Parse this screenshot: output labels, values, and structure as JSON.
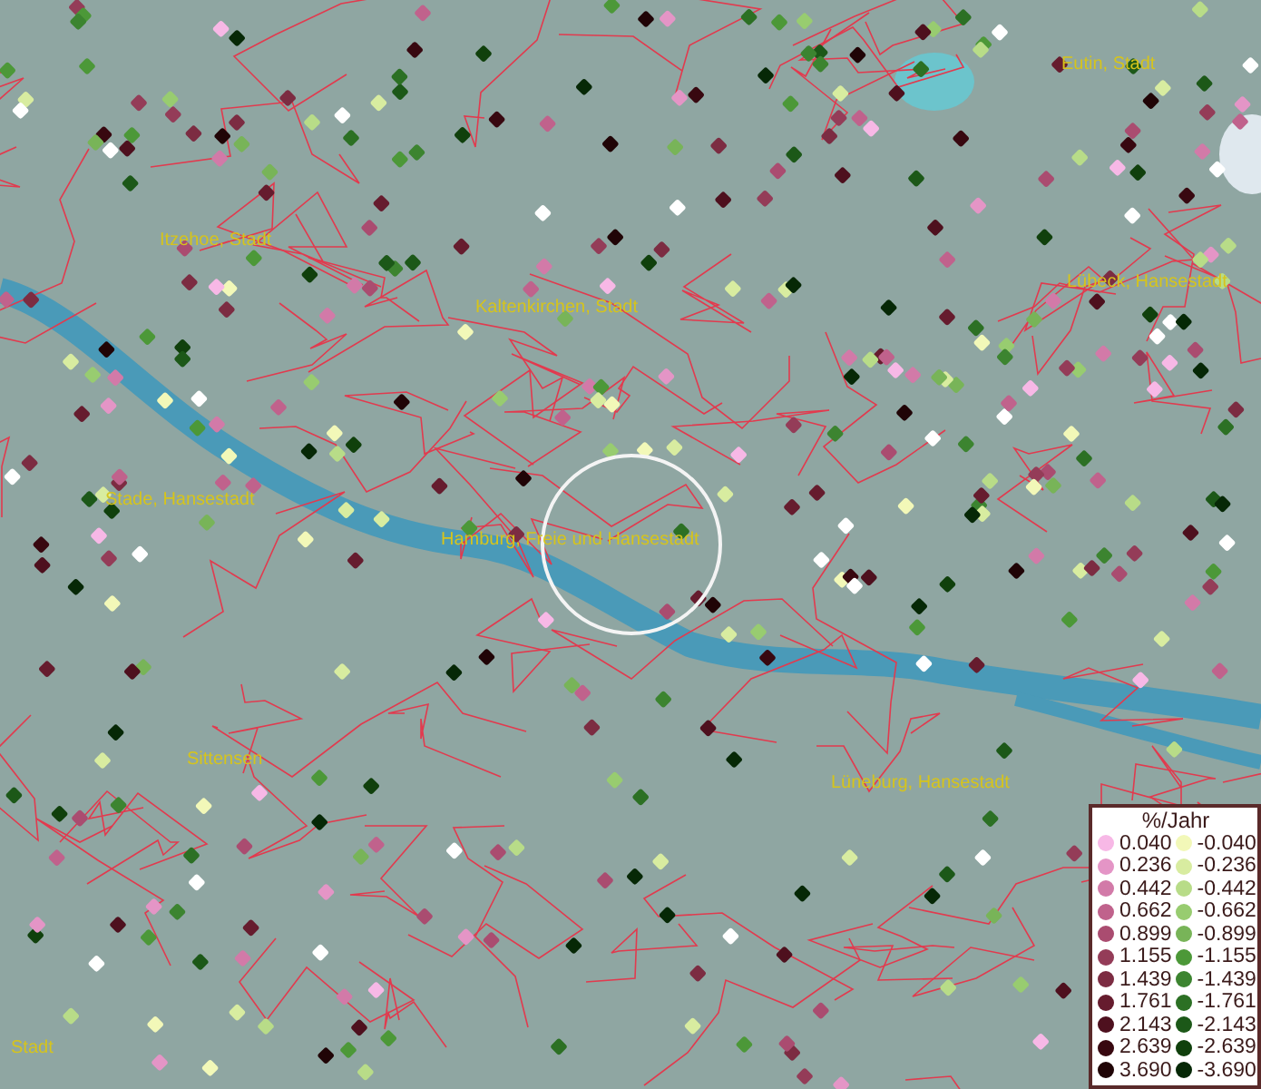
{
  "map": {
    "places": [
      {
        "label": "Eutin, Stadt"
      },
      {
        "label": "Itzehoe, Stadt"
      },
      {
        "label": "Lübeck, Hansestadt"
      },
      {
        "label": "Kaltenkirchen, Stadt"
      },
      {
        "label": "Stade, Hansestadt"
      },
      {
        "label": "Hamburg, Freie und Hansestadt"
      },
      {
        "label": "Sittensen"
      },
      {
        "label": "Lüneburg, Hansestadt"
      },
      {
        "label": "Stadt"
      }
    ]
  },
  "legend": {
    "title": "%/Jahr",
    "increase": [
      {
        "label": "0.040",
        "color": "#f7b8e6"
      },
      {
        "label": "0.236",
        "color": "#e495c6"
      },
      {
        "label": "0.442",
        "color": "#d27aa8"
      },
      {
        "label": "0.662",
        "color": "#c0628c"
      },
      {
        "label": "0.899",
        "color": "#aa4c70"
      },
      {
        "label": "1.155",
        "color": "#943c58"
      },
      {
        "label": "1.439",
        "color": "#7c2c42"
      },
      {
        "label": "1.761",
        "color": "#661c2e"
      },
      {
        "label": "2.143",
        "color": "#4e101e"
      },
      {
        "label": "2.639",
        "color": "#380810"
      },
      {
        "label": "3.690",
        "color": "#200406"
      }
    ],
    "decrease": [
      {
        "label": "-0.040",
        "color": "#f2f8b8"
      },
      {
        "label": "-0.236",
        "color": "#d8eca0"
      },
      {
        "label": "-0.442",
        "color": "#b8dc88"
      },
      {
        "label": "-0.662",
        "color": "#98cc70"
      },
      {
        "label": "-0.899",
        "color": "#78b458"
      },
      {
        "label": "-1.155",
        "color": "#4c9838"
      },
      {
        "label": "-1.439",
        "color": "#3c8430"
      },
      {
        "label": "-1.761",
        "color": "#2c7024"
      },
      {
        "label": "-2.143",
        "color": "#1c5818"
      },
      {
        "label": "-2.639",
        "color": "#10400c"
      },
      {
        "label": "-3.690",
        "color": "#062806"
      }
    ]
  }
}
